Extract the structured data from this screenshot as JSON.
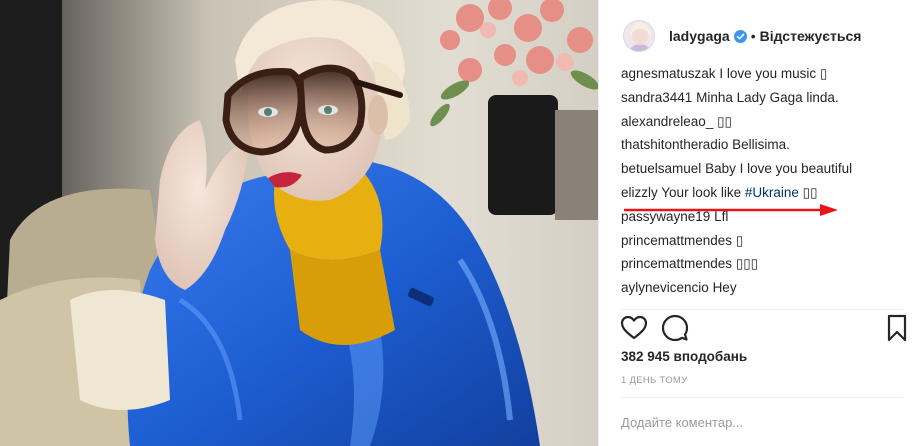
{
  "post": {
    "username": "ladygaga",
    "separator": "•",
    "follow_label": "Відстежується",
    "likes_text": "382 945 вподобань",
    "time_ago": "1 ДЕНЬ ТОМУ",
    "comment_placeholder": "Додайте коментар...",
    "colors": {
      "coat_blue": "#1f5fd0",
      "turtleneck_yellow": "#e7b010",
      "link_blue": "#003569",
      "arrow_red": "#e8141a"
    }
  },
  "comments": [
    {
      "user": "agnesmatuszak",
      "text": "I love you music",
      "emoji": "▯"
    },
    {
      "user": "sandra3441",
      "text": "Minha Lady Gaga linda."
    },
    {
      "user": "alexandreleao_",
      "text": "",
      "emoji": "▯▯"
    },
    {
      "user": "thatshitontheradio",
      "text": "Bellisima."
    },
    {
      "user": "betuelsamuel",
      "text": "Baby I love you beautiful"
    },
    {
      "user": "elizzly",
      "text": "Your look like",
      "tag": "#Ukraine",
      "emoji": "▯▯"
    },
    {
      "user": "passywayne19",
      "text": "Lfl"
    },
    {
      "user": "princemattmendes",
      "text": "",
      "emoji": "▯"
    },
    {
      "user": "princemattmendes",
      "text": "",
      "emoji": "▯▯▯"
    },
    {
      "user": "aylynevicencio",
      "text": "Hey"
    }
  ],
  "icons": {
    "like": "heart-icon",
    "comment": "speech-bubble-icon",
    "save": "bookmark-icon",
    "verified": "verified-badge-icon"
  }
}
